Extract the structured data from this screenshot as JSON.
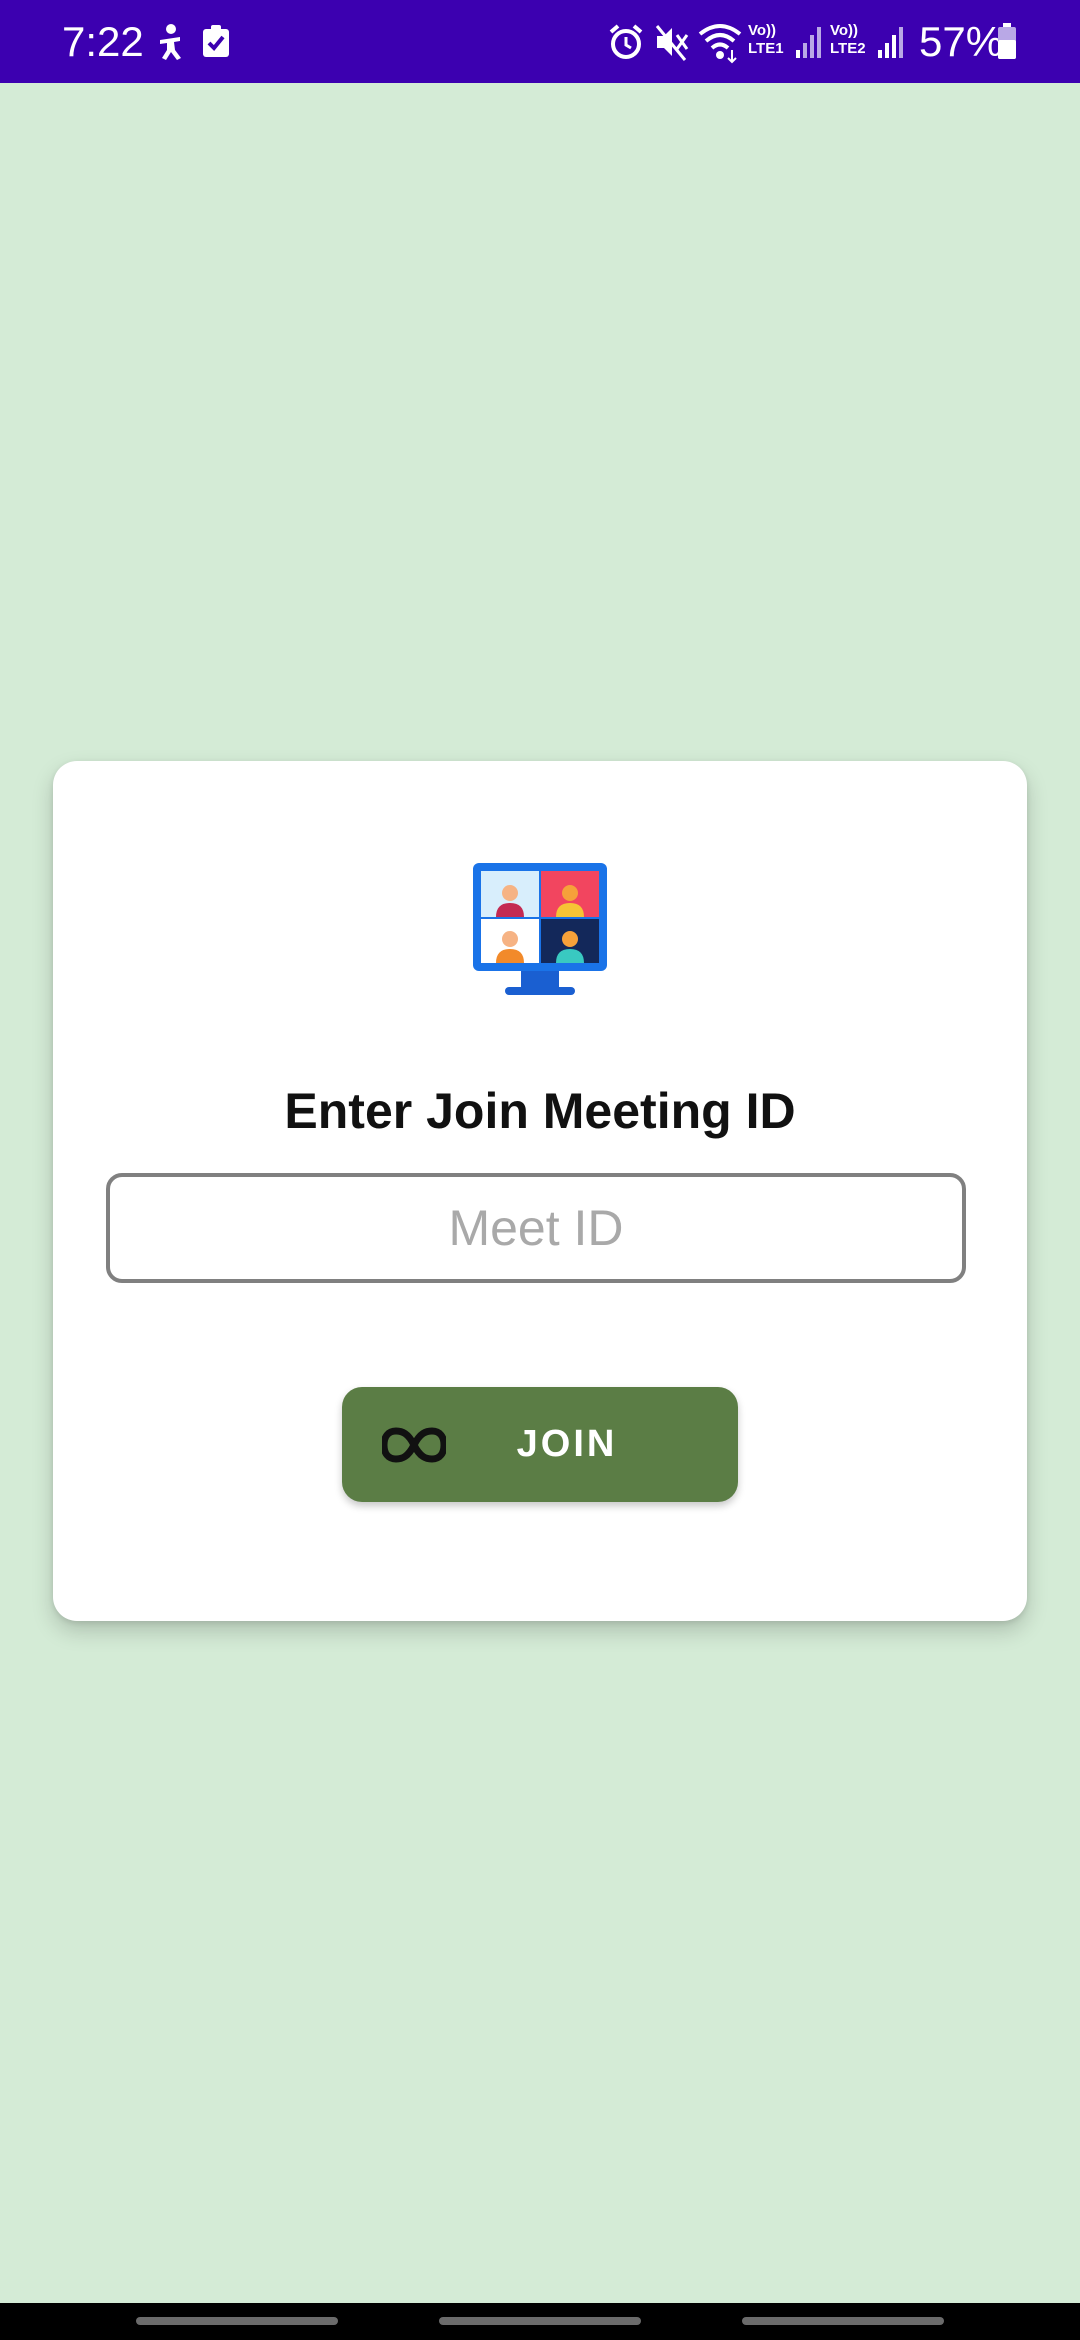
{
  "status_bar": {
    "time": "7:22",
    "battery_percent": "57%",
    "sim1_label": "Vo))\nLTE1",
    "sim2_label": "Vo))\nLTE2",
    "background_color": "#3c00b0",
    "icons": [
      "accessibility-icon",
      "task-check-icon",
      "alarm-icon",
      "mute-icon",
      "wifi-icon",
      "signal-icon",
      "signal-icon",
      "battery-icon"
    ]
  },
  "join_card": {
    "illustration": "video-conference-icon",
    "title": "Enter Join Meeting ID",
    "meet_id_input": {
      "value": "",
      "placeholder": "Meet ID"
    },
    "join_button": {
      "label": "JOIN",
      "icon": "link-icon",
      "color": "#5b7d45"
    }
  },
  "theme": {
    "background_color": "#d4ebd6",
    "card_color": "#ffffff"
  }
}
